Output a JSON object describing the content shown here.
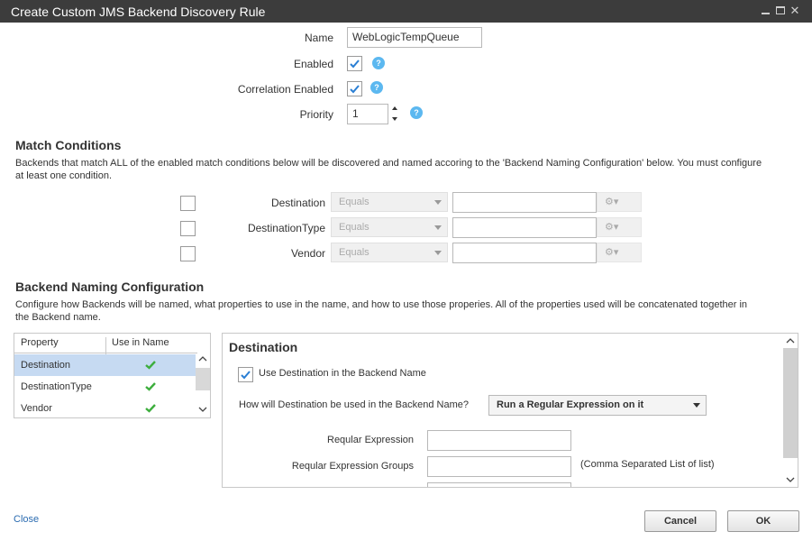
{
  "window": {
    "title": "Create Custom JMS Backend Discovery Rule"
  },
  "form": {
    "name_label": "Name",
    "name_value": "WebLogicTempQueue",
    "enabled_label": "Enabled",
    "enabled_checked": true,
    "correlation_label": "Correlation Enabled",
    "correlation_checked": true,
    "priority_label": "Priority",
    "priority_value": "1",
    "help_glyph": "?"
  },
  "match": {
    "heading": "Match Conditions",
    "description_1": "Backends that match ALL of the enabled match conditions below will be discovered and named accoring to the 'Backend Naming Configuration' below.  You must configure",
    "description_2": "at least one condition.",
    "conditions": [
      {
        "label": "Destination",
        "operator": "Equals"
      },
      {
        "label": "DestinationType",
        "operator": "Equals"
      },
      {
        "label": "Vendor",
        "operator": "Equals"
      }
    ]
  },
  "naming": {
    "heading": "Backend Naming Configuration",
    "description_1": "Configure how Backends will be named, what properties to use in the name, and how to use those properies.  All of the properties used will be concatenated together in",
    "description_2": "the Backend name.",
    "table": {
      "col_property": "Property",
      "col_use": "Use in Name",
      "rows": [
        {
          "name": "Destination",
          "used": true
        },
        {
          "name": "DestinationType",
          "used": true
        },
        {
          "name": "Vendor",
          "used": true
        }
      ]
    },
    "detail": {
      "title": "Destination",
      "use_label": "Use Destination in the Backend Name",
      "how_label": "How will Destination be used in the Backend Name?",
      "how_value": "Run a Regular Expression on it",
      "regex_label": "Reqular Expression",
      "groups_label": "Reqular Expression Groups",
      "groups_hint": "(Comma Separated List of list)"
    }
  },
  "footer": {
    "close_label": "Close",
    "cancel_label": "Cancel",
    "ok_label": "OK"
  },
  "colors": {
    "titlebar": "#3c3c3c",
    "check": "#2a7fd4",
    "help": "#5cb8f0",
    "used_check": "#3dae3d",
    "link": "#2a6bb0"
  }
}
